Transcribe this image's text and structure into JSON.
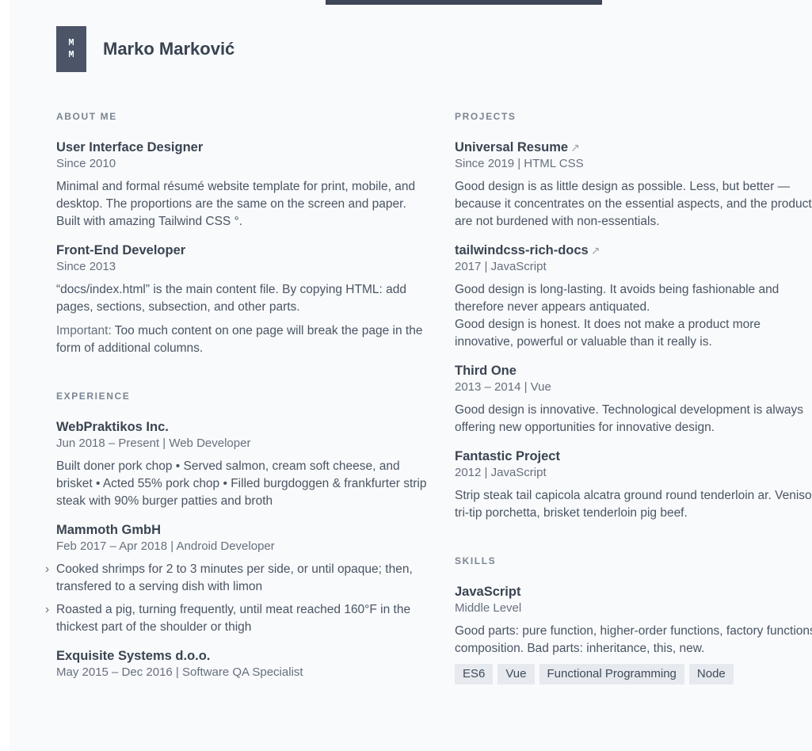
{
  "header": {
    "monogram_top": "M",
    "monogram_bottom": "M",
    "name": "Marko Marković"
  },
  "about": {
    "title": "ABOUT ME",
    "entries": [
      {
        "title": "User Interface Designer",
        "sub": "Since 2010",
        "text": "Minimal and formal résumé website template for print, mobile, and desktop. The proportions are the same on the screen and paper. Built with amazing Tailwind CSS °."
      },
      {
        "title": "Front-End Developer",
        "sub": "Since 2013",
        "text": "“docs/index.html” is the main content file. By copying HTML: add pages, sections, subsection, and other parts.",
        "important_label": "Important:",
        "important_text": " Too much content on one page will break the page in the form of additional columns."
      }
    ]
  },
  "experience": {
    "title": "EXPERIENCE",
    "entries": [
      {
        "title": "WebPraktikos Inc.",
        "sub": "Jun 2018 – Present | Web Developer",
        "text": "Built doner pork chop • Served salmon, cream soft cheese, and brisket • Acted 55% pork chop • Filled burgdoggen & frankfurter strip steak with 90% burger patties and broth"
      },
      {
        "title": "Mammoth GmbH",
        "sub": "Feb 2017 – Apr 2018 | Android Developer",
        "bullets": [
          "Cooked shrimps for 2 to 3 minutes per side, or until opaque; then, transfered to a serving dish with limon",
          "Roasted a pig, turning frequently, until meat reached 160°F in the thickest part of the shoulder or thigh"
        ]
      },
      {
        "title": "Exquisite Systems d.o.o.",
        "sub": "May 2015 – Dec 2016 | Software QA Specialist"
      }
    ]
  },
  "projects": {
    "title": "PROJECTS",
    "entries": [
      {
        "title": "Universal Resume",
        "arrow": "↗",
        "sub": "Since 2019 | HTML CSS",
        "text": "Good design is as little design as possible. Less, but better — because it concentrates on the essential aspects, and the products are not burdened with non-essentials."
      },
      {
        "title": "tailwindcss-rich-docs",
        "arrow": "↗",
        "sub": "2017 | JavaScript",
        "text": "Good design is long-lasting. It avoids being fashionable and therefore never appears antiquated.",
        "text2": "Good design is honest. It does not make a product more innovative, powerful or valuable than it really is."
      },
      {
        "title": "Third One",
        "sub": "2013 – 2014 | Vue",
        "text": "Good design is innovative. Technological development is always offering new opportunities for innovative design."
      },
      {
        "title": "Fantastic Project",
        "sub": "2012 | JavaScript",
        "text": "Strip steak tail capicola alcatra ground round tenderloin ar. Venison tri-tip porchetta, brisket tenderloin pig beef."
      }
    ]
  },
  "skills": {
    "title": "SKILLS",
    "entries": [
      {
        "title": "JavaScript",
        "sub": "Middle Level",
        "text": "Good parts: pure function, higher-order functions, factory functions, composition. Bad parts: inheritance, this, new.",
        "tags": [
          "ES6",
          "Vue",
          "Functional Programming",
          "Node"
        ]
      }
    ]
  }
}
